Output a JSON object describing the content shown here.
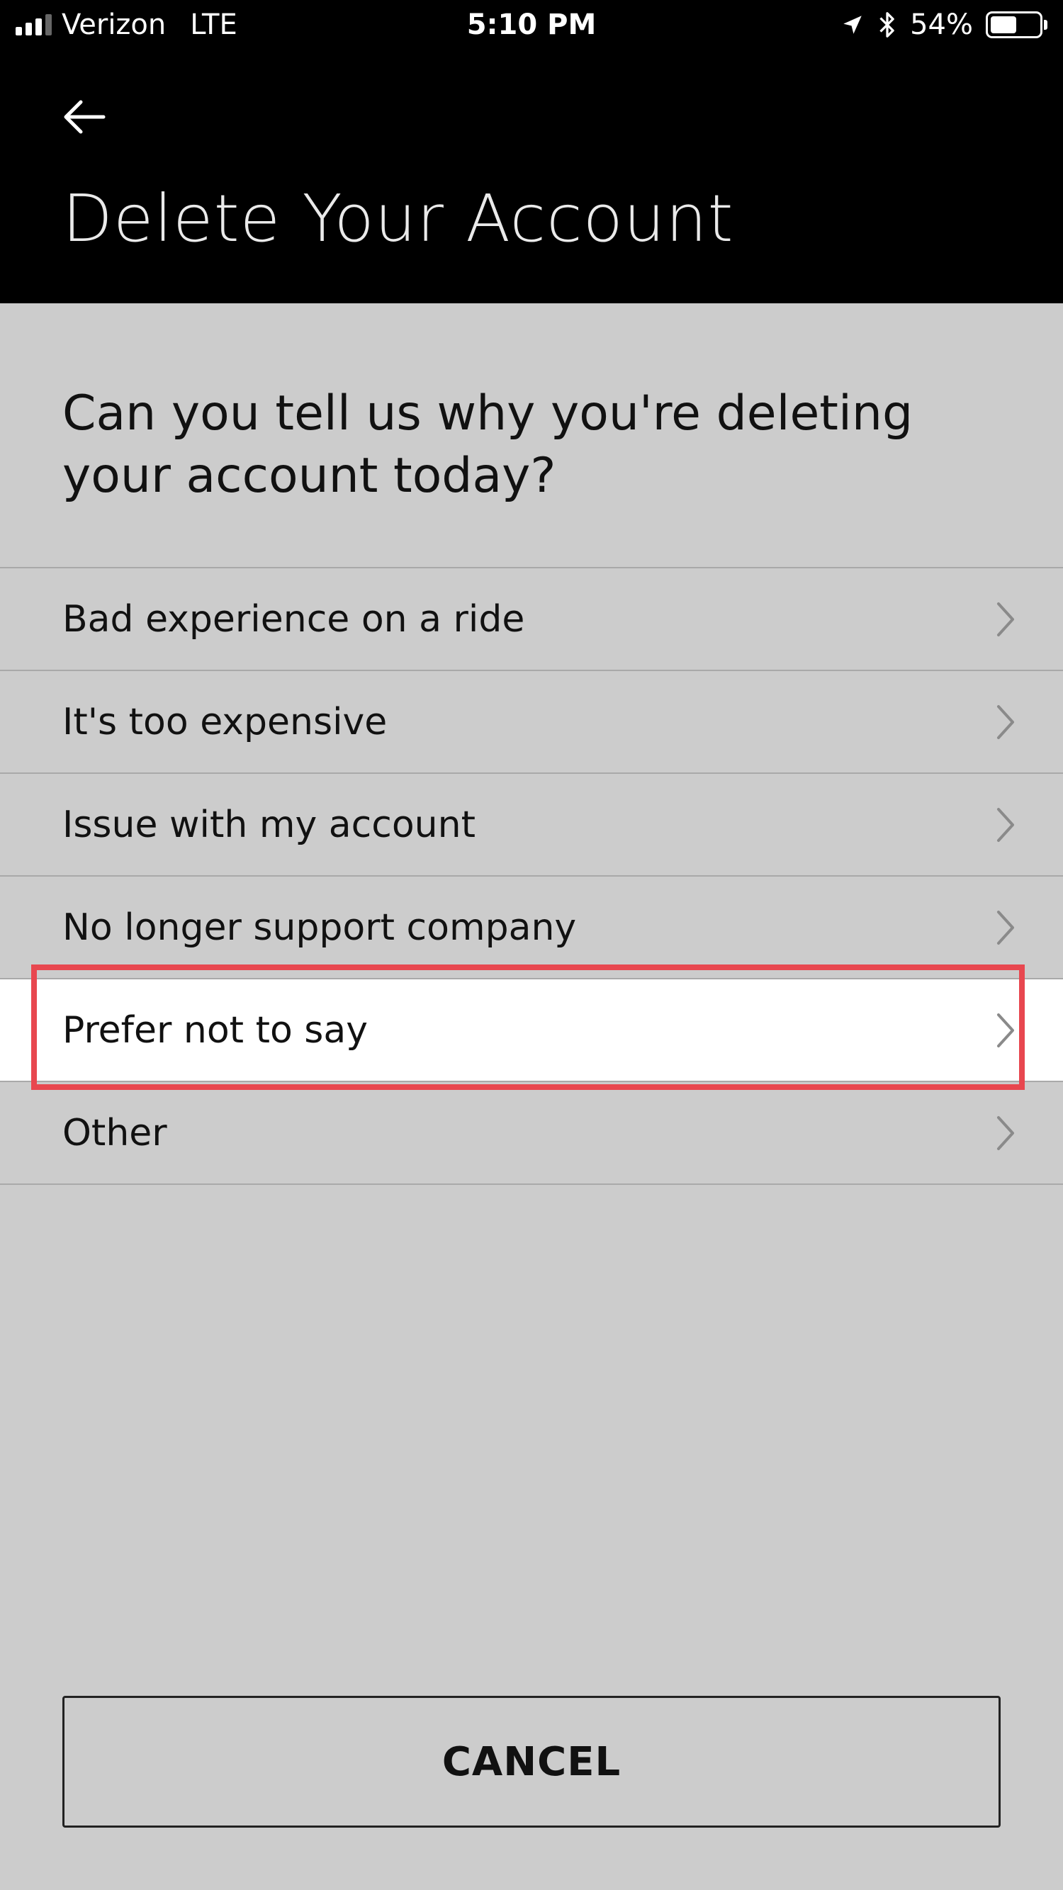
{
  "status_bar": {
    "carrier": "Verizon",
    "network": "LTE",
    "time": "5:10 PM",
    "battery_percent_text": "54%",
    "battery_level": 0.54,
    "signal_bars_active": 3,
    "signal_bars_total": 4
  },
  "header": {
    "back_icon": "arrow-left-icon",
    "title": "Delete Your Account"
  },
  "question": "Can you tell us why you're deleting your account today?",
  "reasons": [
    {
      "label": "Bad experience on a ride",
      "highlighted": false
    },
    {
      "label": "It's too expensive",
      "highlighted": false
    },
    {
      "label": "Issue with my account",
      "highlighted": false
    },
    {
      "label": "No longer support company",
      "highlighted": false
    },
    {
      "label": "Prefer not to say",
      "highlighted": true
    },
    {
      "label": "Other",
      "highlighted": false
    }
  ],
  "cancel_label": "CANCEL",
  "colors": {
    "header_bg": "#000000",
    "page_bg": "#cccccc",
    "highlight_border": "#e8474f",
    "highlight_bg": "#ffffff"
  }
}
